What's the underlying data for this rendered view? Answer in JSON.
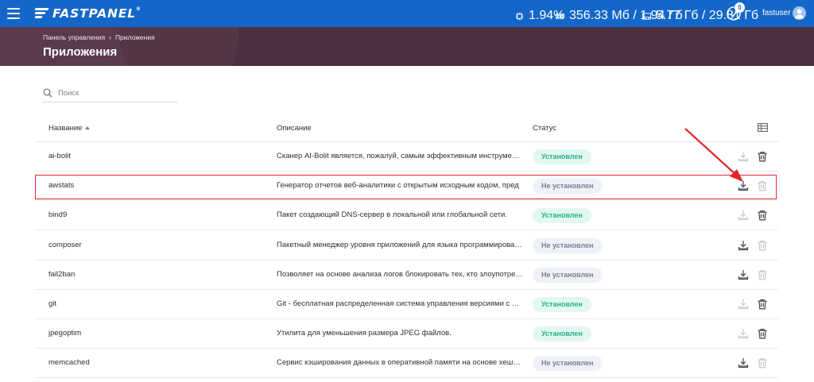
{
  "app": {
    "logo_text": "FASTPANEL",
    "logo_mark": "®",
    "colors": {
      "topbar": "#1467c8",
      "banner": "#4a3040",
      "installed": "#20b489",
      "not_installed": "#7a8190",
      "highlight": "#e0262a"
    }
  },
  "topbar": {
    "cpu": "1.94%",
    "ram": "356.33 Мб / 1.94 Гб",
    "disk": "5.77 Гб / 29.81 Гб",
    "tasks_count": "0",
    "user": "fastuser"
  },
  "header": {
    "breadcrumb": [
      "Панель управления",
      "Приложения"
    ],
    "breadcrumb_sep": "›",
    "title": "Приложения"
  },
  "search": {
    "placeholder": "Поиск",
    "value": ""
  },
  "table": {
    "columns": [
      "Название",
      "Описание",
      "Статус"
    ],
    "rows": [
      {
        "name": "ai-bolit",
        "description": "Сканер AI-Bolit является, пожалуй, самым эффективным инструментом",
        "status": "Установлен",
        "installed": true
      },
      {
        "name": "awstats",
        "description": "Генератор отчетов веб-аналитики с открытым исходным кодом, пред",
        "status": "Не установлен",
        "installed": false
      },
      {
        "name": "bind9",
        "description": "Пакет создающий DNS-сервер в локальной или глобальной сети.",
        "status": "Установлен",
        "installed": true
      },
      {
        "name": "composer",
        "description": "Пакетный менеджер уровня приложений для языка программирования",
        "status": "Не установлен",
        "installed": false
      },
      {
        "name": "fail2ban",
        "description": "Позволяет на основе анализа логов блокировать тех, кто злоупотребляет",
        "status": "Не установлен",
        "installed": false
      },
      {
        "name": "git",
        "description": "Git - бесплатная распределенная система управления версиями с открытым",
        "status": "Установлен",
        "installed": true
      },
      {
        "name": "jpegoptim",
        "description": "Утилита для уменьшения размера JPEG файлов.",
        "status": "Установлен",
        "installed": true
      },
      {
        "name": "memcached",
        "description": "Сервис кэширования данных в оперативной памяти на основе хеш-таблиц",
        "status": "Не установлен",
        "installed": false
      }
    ]
  },
  "icons": {
    "menu": "hamburger-icon",
    "cpu": "cpu-chip-icon",
    "ram": "memory-icon",
    "disk": "hard-drive-icon",
    "tasks": "check-circle-icon",
    "user": "user-avatar-icon",
    "search": "search-icon",
    "columns": "table-columns-icon",
    "install": "download-tray-icon",
    "delete": "trash-icon"
  }
}
